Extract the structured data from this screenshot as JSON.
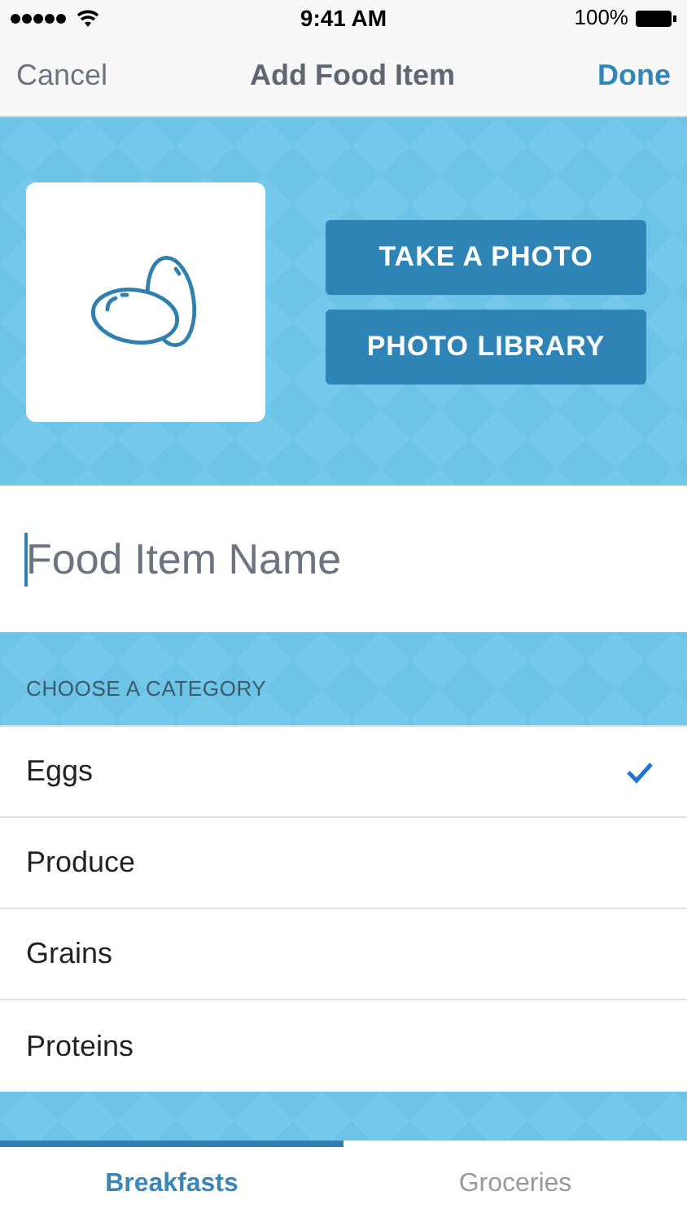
{
  "status_bar": {
    "time": "9:41 AM",
    "battery": "100%"
  },
  "nav": {
    "cancel": "Cancel",
    "title": "Add Food Item",
    "done": "Done"
  },
  "photo": {
    "buttons": [
      "TAKE A PHOTO",
      "PHOTO LIBRARY"
    ]
  },
  "name_field": {
    "placeholder": "Food Item Name",
    "focused": true
  },
  "category": {
    "header": "CHOOSE A CATEGORY",
    "items": [
      {
        "label": "Eggs",
        "selected": true
      },
      {
        "label": "Produce",
        "selected": false
      },
      {
        "label": "Grains",
        "selected": false
      },
      {
        "label": "Proteins",
        "selected": false
      }
    ]
  },
  "tabs": [
    {
      "label": "Breakfasts",
      "selected": true
    },
    {
      "label": "Groceries",
      "selected": false
    }
  ]
}
